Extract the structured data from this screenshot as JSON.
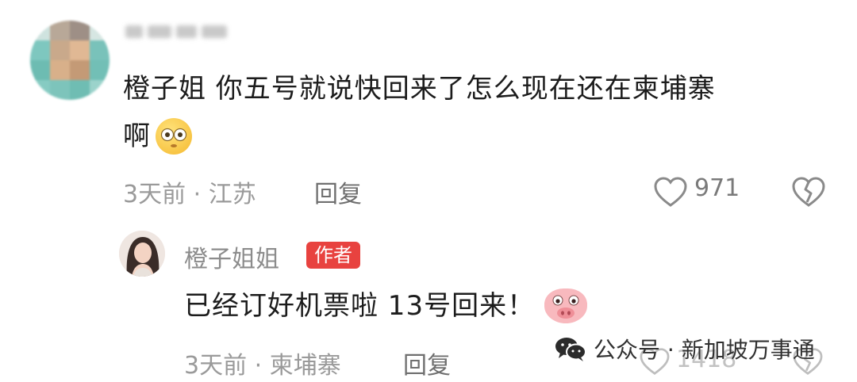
{
  "comment": {
    "text_line1": "橙子姐 你五号就说快回来了怎么现在还在柬埔寨",
    "text_line2": "啊",
    "emoji": "flushed-emoji",
    "meta": "3天前 · 江苏",
    "reply_label": "回复",
    "like_count": "971"
  },
  "reply": {
    "username": "橙子姐姐",
    "badge": "作者",
    "text": "已经订好机票啦 13号回来！",
    "emoji": "pig-emoji",
    "meta": "3天前 · 柬埔寨",
    "reply_label": "回复",
    "like_count": "1418"
  },
  "watermark": {
    "text": "公众号 · 新加坡万事通",
    "icon": "wechat-icon"
  },
  "colors": {
    "badge": "#e8423f",
    "meta_text": "#9a9a9a"
  }
}
